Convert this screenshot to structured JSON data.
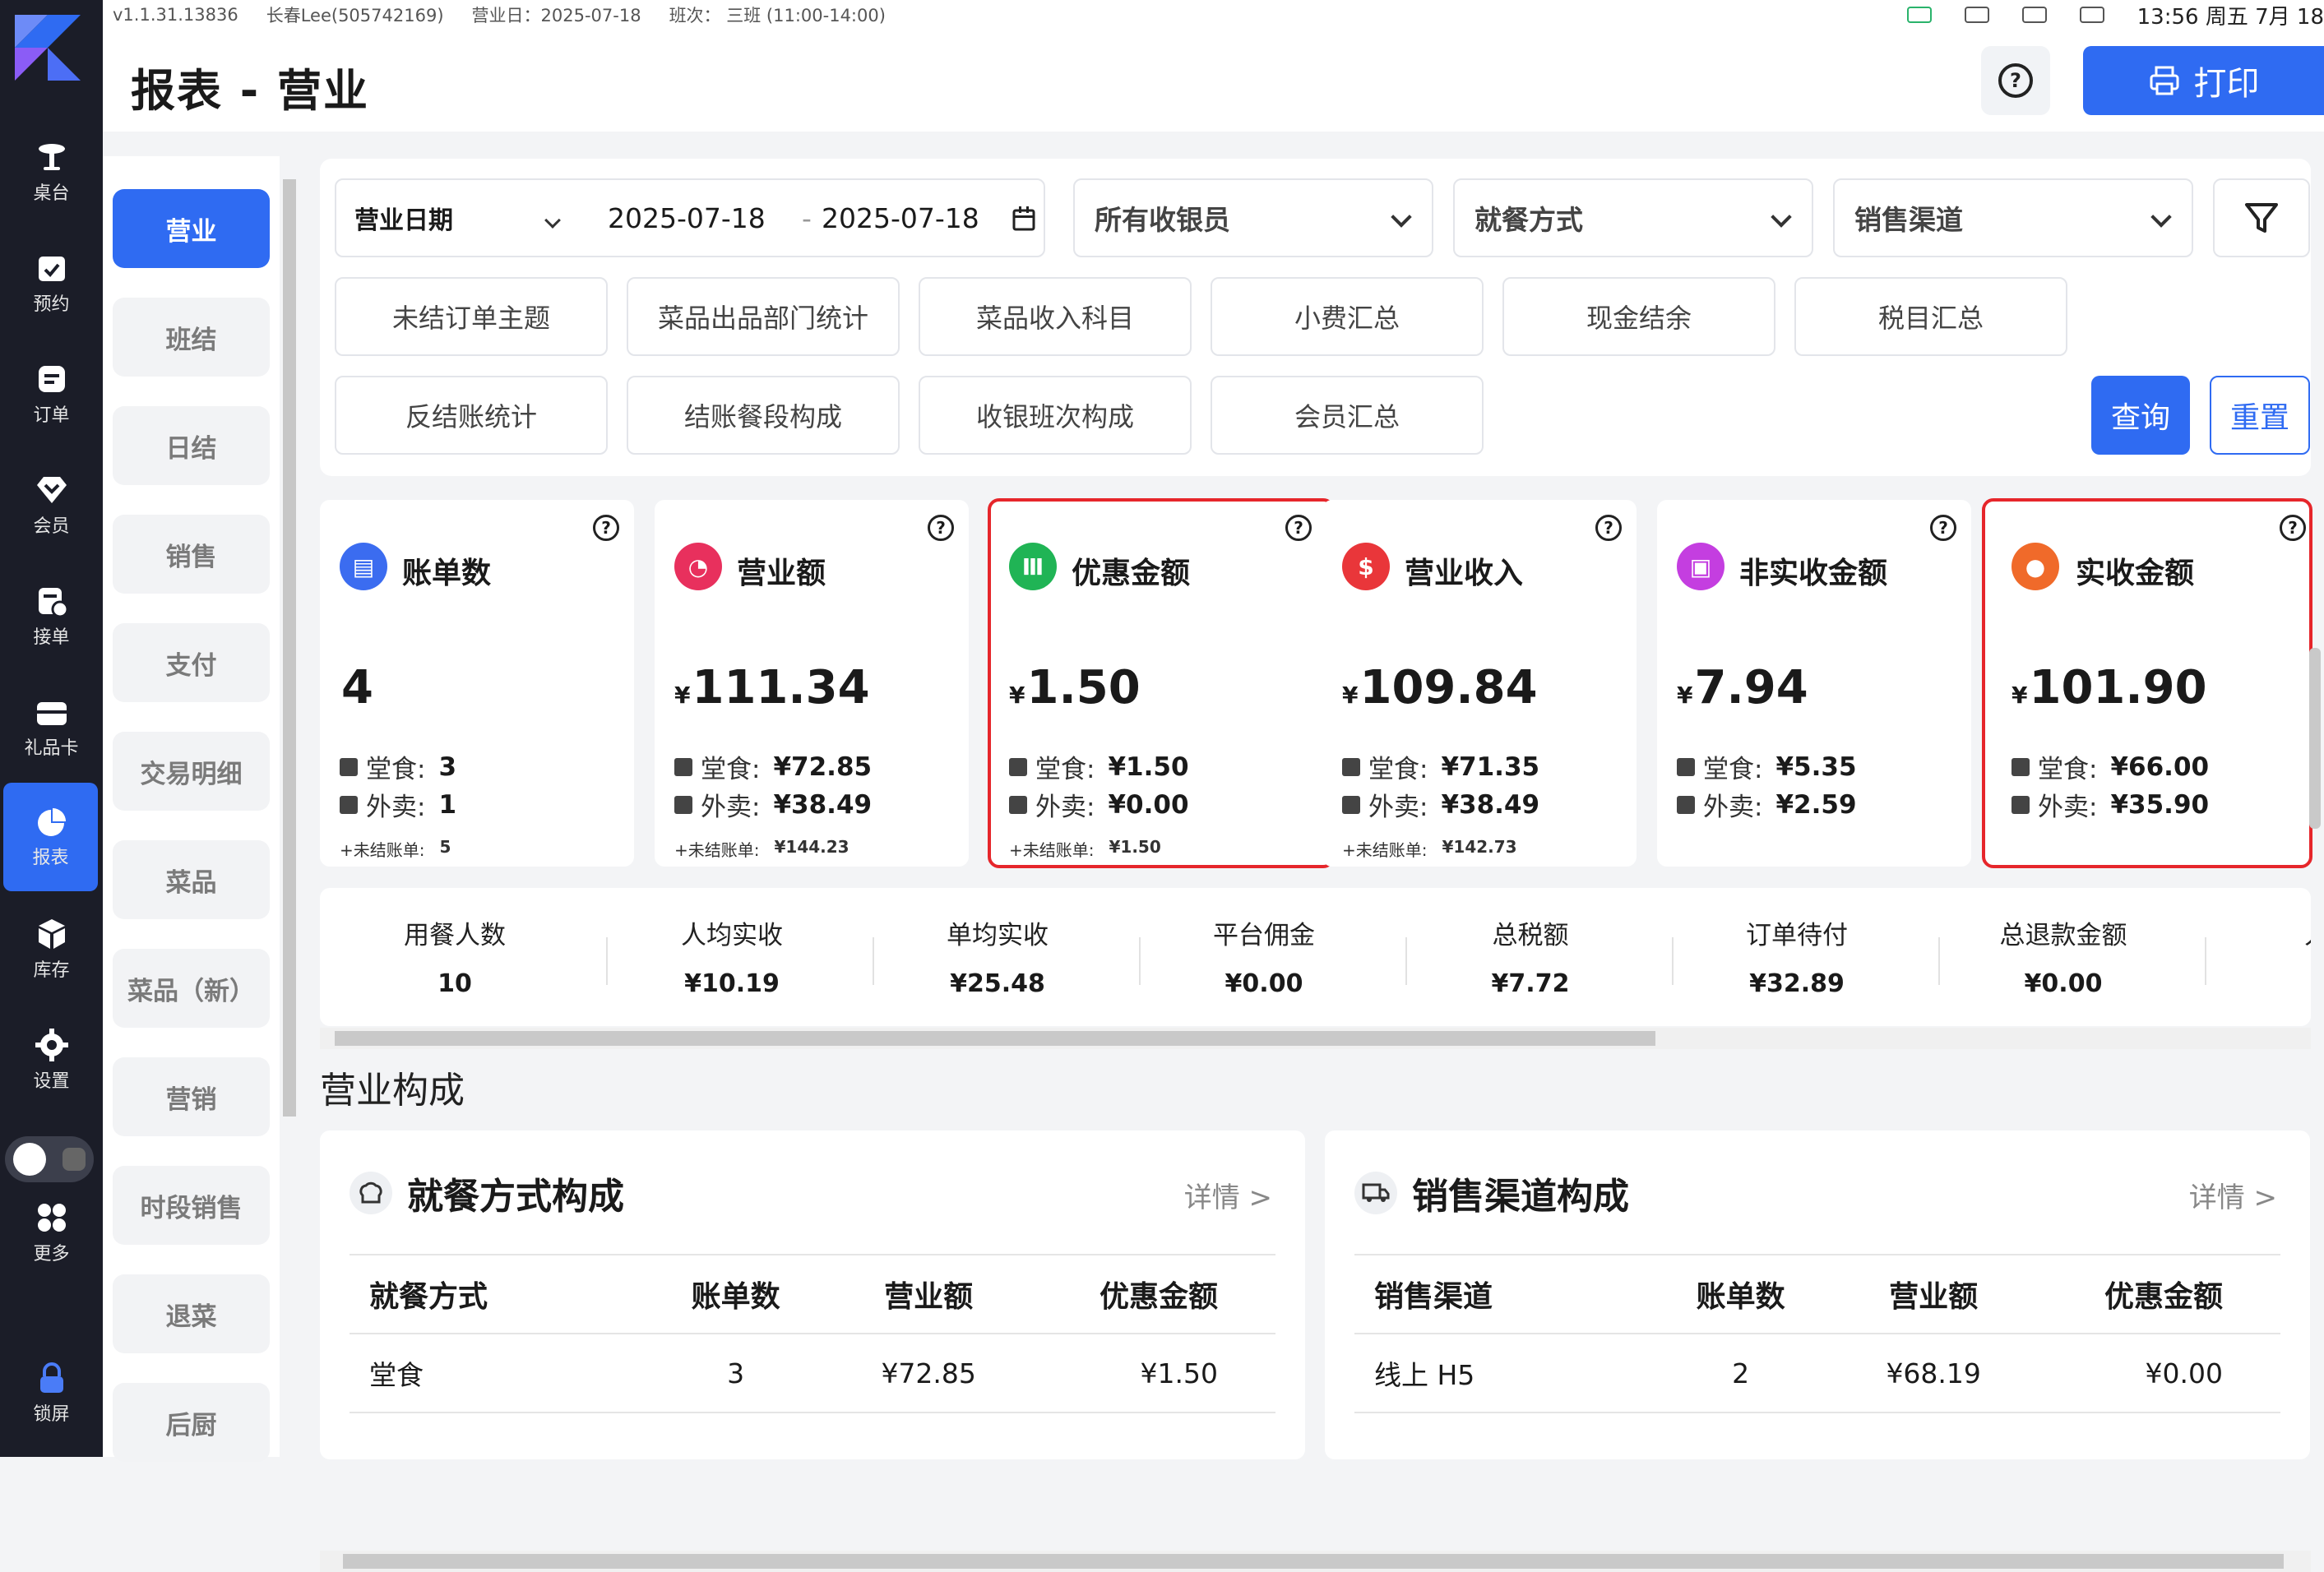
{
  "status_bar": {
    "version": "v1.1.31.13836",
    "user": "长春Lee(505742169)",
    "business_day": "营业日：2025-07-18",
    "shift": "班次： 三班 (11:00-14:00)",
    "time": "13:56 周五 7月 18"
  },
  "sidebar": {
    "items": [
      {
        "label": "桌台",
        "icon": "table-icon"
      },
      {
        "label": "预约",
        "icon": "calendar-check-icon"
      },
      {
        "label": "订单",
        "icon": "order-icon"
      },
      {
        "label": "会员",
        "icon": "diamond-icon"
      },
      {
        "label": "接单",
        "icon": "accept-order-icon"
      },
      {
        "label": "礼品卡",
        "icon": "gift-card-icon"
      },
      {
        "label": "报表",
        "icon": "pie-chart-icon"
      },
      {
        "label": "库存",
        "icon": "cube-icon"
      },
      {
        "label": "设置",
        "icon": "gear-icon"
      },
      {
        "label": "更多",
        "icon": "grid-icon"
      },
      {
        "label": "锁屏",
        "icon": "lock-icon"
      }
    ]
  },
  "header": {
    "title": "报表 - 营业",
    "print_label": "打印"
  },
  "subnav": {
    "items": [
      "营业",
      "班结",
      "日结",
      "销售",
      "支付",
      "交易明细",
      "菜品",
      "菜品（新）",
      "营销",
      "时段销售",
      "退菜",
      "后厨"
    ]
  },
  "filters": {
    "date_type": "营业日期",
    "date_start": "2025-07-18",
    "date_sep": "-",
    "date_end": "2025-07-18",
    "cashier": "所有收银员",
    "dining_mode": "就餐方式",
    "channel": "销售渠道",
    "tags_row1": [
      "未结订单主题",
      "菜品出品部门统计",
      "菜品收入科目",
      "小费汇总",
      "现金结余",
      "税目汇总"
    ],
    "tags_row2": [
      "反结账统计",
      "结账餐段构成",
      "收银班次构成",
      "会员汇总"
    ],
    "query_label": "查询",
    "reset_label": "重置"
  },
  "stat_cards": [
    {
      "title": "账单数",
      "currency": "",
      "amount": "4",
      "dine_label": "堂食:",
      "dine_value": "3",
      "takeout_label": "外卖:",
      "takeout_value": "1",
      "unsettled_label": "+未结账单:",
      "unsettled_value": "5",
      "color": "#3b6cf0",
      "highlight": false
    },
    {
      "title": "营业额",
      "currency": "¥",
      "amount": "111.34",
      "dine_label": "堂食:",
      "dine_value": "¥72.85",
      "takeout_label": "外卖:",
      "takeout_value": "¥38.49",
      "unsettled_label": "+未结账单:",
      "unsettled_value": "¥144.23",
      "color": "#e8305d",
      "highlight": false
    },
    {
      "title": "优惠金额",
      "currency": "¥",
      "amount": "1.50",
      "dine_label": "堂食:",
      "dine_value": "¥1.50",
      "takeout_label": "外卖:",
      "takeout_value": "¥0.00",
      "unsettled_label": "+未结账单:",
      "unsettled_value": "¥1.50",
      "color": "#20b455",
      "highlight": true
    },
    {
      "title": "营业收入",
      "currency": "¥",
      "amount": "109.84",
      "dine_label": "堂食:",
      "dine_value": "¥71.35",
      "takeout_label": "外卖:",
      "takeout_value": "¥38.49",
      "unsettled_label": "+未结账单:",
      "unsettled_value": "¥142.73",
      "color": "#e9363a",
      "highlight": false
    },
    {
      "title": "非实收金额",
      "currency": "¥",
      "amount": "7.94",
      "dine_label": "堂食:",
      "dine_value": "¥5.35",
      "takeout_label": "外卖:",
      "takeout_value": "¥2.59",
      "unsettled_label": "",
      "unsettled_value": "",
      "color": "#c43ee0",
      "highlight": false
    },
    {
      "title": "实收金额",
      "currency": "¥",
      "amount": "101.90",
      "dine_label": "堂食:",
      "dine_value": "¥66.00",
      "takeout_label": "外卖:",
      "takeout_value": "¥35.90",
      "unsettled_label": "",
      "unsettled_value": "",
      "color": "#f06a2a",
      "highlight": true
    }
  ],
  "metrics": [
    {
      "label": "用餐人数",
      "value": "10"
    },
    {
      "label": "人均实收",
      "value": "¥10.19"
    },
    {
      "label": "单均实收",
      "value": "¥25.48"
    },
    {
      "label": "平台佣金",
      "value": "¥0.00"
    },
    {
      "label": "总税额",
      "value": "¥7.72"
    },
    {
      "label": "订单待付",
      "value": "¥32.89"
    },
    {
      "label": "总退款金额",
      "value": "¥0.00"
    },
    {
      "label": "人均",
      "value": ""
    }
  ],
  "composition": {
    "section_title": "营业构成",
    "cards": [
      {
        "title": "就餐方式构成",
        "more": "详情 >",
        "icon": "chef-hat-icon",
        "headers": [
          "就餐方式",
          "账单数",
          "营业额",
          "优惠金额"
        ],
        "rows": [
          [
            "堂食",
            "3",
            "¥72.85",
            "¥1.50"
          ]
        ]
      },
      {
        "title": "销售渠道构成",
        "more": "详情 >",
        "icon": "truck-icon",
        "headers": [
          "销售渠道",
          "账单数",
          "营业额",
          "优惠金额"
        ],
        "rows": [
          [
            "线上 H5",
            "2",
            "¥68.19",
            "¥0.00"
          ]
        ]
      }
    ]
  }
}
